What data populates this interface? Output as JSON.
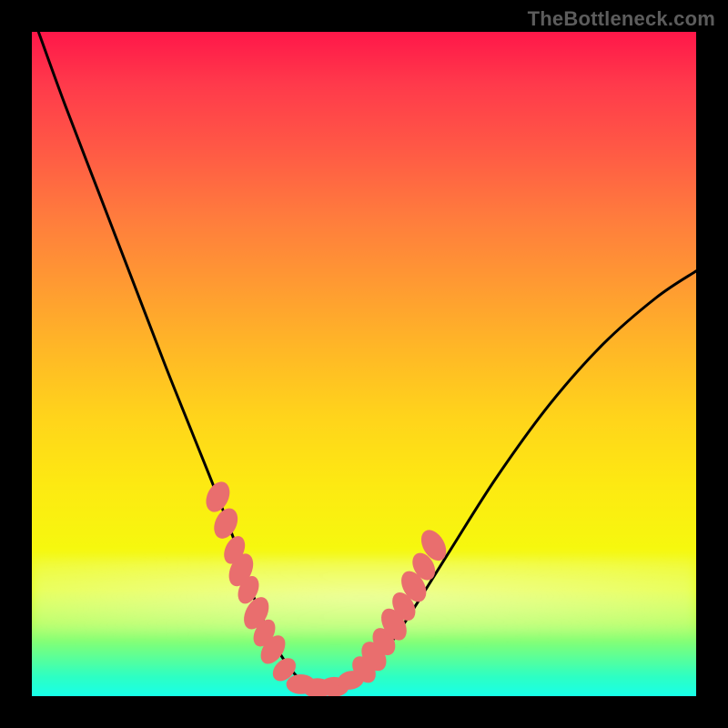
{
  "watermark": "TheBottleneck.com",
  "colors": {
    "frame": "#000000",
    "curve": "#000000",
    "marker": "#e96e6e"
  },
  "chart_data": {
    "type": "line",
    "title": "",
    "xlabel": "",
    "ylabel": "",
    "xlim": [
      0,
      100
    ],
    "ylim": [
      0,
      100
    ],
    "grid": false,
    "legend": false,
    "annotations": [
      "TheBottleneck.com"
    ],
    "series": [
      {
        "name": "bottleneck-curve",
        "x": [
          1,
          5,
          10,
          15,
          20,
          24,
          28,
          31,
          33,
          35,
          37,
          39,
          41,
          43,
          45,
          47,
          50,
          54,
          58,
          63,
          70,
          78,
          86,
          94,
          100
        ],
        "y": [
          100,
          89,
          76,
          63,
          50,
          40,
          30,
          22,
          16,
          11,
          7,
          4,
          2,
          1,
          1,
          2,
          4,
          8,
          14,
          22,
          33,
          44,
          53,
          60,
          64
        ]
      }
    ],
    "markers": {
      "name": "beads",
      "color": "#e96e6e",
      "points": [
        {
          "x": 28.0,
          "y": 30.0,
          "rx": 1.6,
          "ry": 2.4,
          "rot": 25
        },
        {
          "x": 29.2,
          "y": 26.0,
          "rx": 1.6,
          "ry": 2.4,
          "rot": 25
        },
        {
          "x": 30.5,
          "y": 22.0,
          "rx": 1.4,
          "ry": 2.2,
          "rot": 25
        },
        {
          "x": 31.5,
          "y": 19.0,
          "rx": 1.6,
          "ry": 2.6,
          "rot": 25
        },
        {
          "x": 32.6,
          "y": 16.0,
          "rx": 1.4,
          "ry": 2.2,
          "rot": 25
        },
        {
          "x": 33.8,
          "y": 12.5,
          "rx": 1.6,
          "ry": 2.6,
          "rot": 28
        },
        {
          "x": 35.0,
          "y": 9.5,
          "rx": 1.4,
          "ry": 2.2,
          "rot": 30
        },
        {
          "x": 36.3,
          "y": 7.0,
          "rx": 1.5,
          "ry": 2.4,
          "rot": 35
        },
        {
          "x": 38.0,
          "y": 4.0,
          "rx": 1.4,
          "ry": 2.0,
          "rot": 45
        },
        {
          "x": 40.5,
          "y": 1.8,
          "rx": 2.2,
          "ry": 1.5,
          "rot": 0
        },
        {
          "x": 43.0,
          "y": 1.2,
          "rx": 2.2,
          "ry": 1.5,
          "rot": 0
        },
        {
          "x": 45.5,
          "y": 1.4,
          "rx": 2.2,
          "ry": 1.5,
          "rot": 0
        },
        {
          "x": 48.0,
          "y": 2.4,
          "rx": 2.0,
          "ry": 1.4,
          "rot": -10
        },
        {
          "x": 50.0,
          "y": 4.0,
          "rx": 1.5,
          "ry": 2.2,
          "rot": -35
        },
        {
          "x": 51.5,
          "y": 6.0,
          "rx": 1.6,
          "ry": 2.4,
          "rot": -32
        },
        {
          "x": 53.0,
          "y": 8.2,
          "rx": 1.5,
          "ry": 2.2,
          "rot": -30
        },
        {
          "x": 54.5,
          "y": 10.8,
          "rx": 1.6,
          "ry": 2.6,
          "rot": -30
        },
        {
          "x": 56.0,
          "y": 13.5,
          "rx": 1.5,
          "ry": 2.3,
          "rot": -30
        },
        {
          "x": 57.5,
          "y": 16.5,
          "rx": 1.6,
          "ry": 2.5,
          "rot": -30
        },
        {
          "x": 59.0,
          "y": 19.5,
          "rx": 1.5,
          "ry": 2.2,
          "rot": -30
        },
        {
          "x": 60.5,
          "y": 22.7,
          "rx": 1.6,
          "ry": 2.5,
          "rot": -30
        }
      ]
    }
  }
}
